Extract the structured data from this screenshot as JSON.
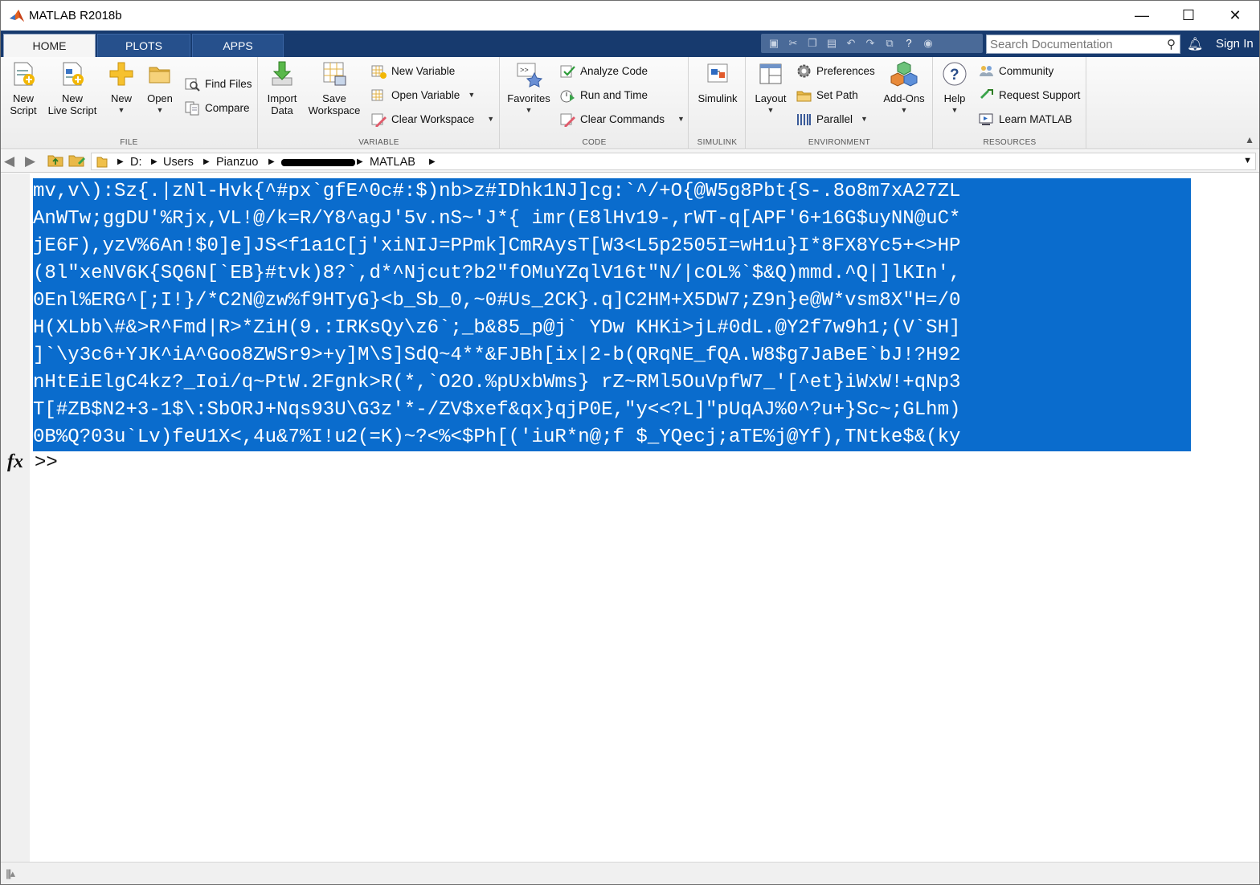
{
  "window": {
    "title": "MATLAB R2018b",
    "minimize": "—",
    "maximize": "☐",
    "close": "✕"
  },
  "tabs": [
    {
      "label": "HOME",
      "active": true
    },
    {
      "label": "PLOTS",
      "active": false
    },
    {
      "label": "APPS",
      "active": false
    }
  ],
  "search": {
    "placeholder": "Search Documentation"
  },
  "account": {
    "sign_in": "Sign In"
  },
  "ribbon": {
    "file": {
      "label": "FILE",
      "new_script": [
        "New",
        "Script"
      ],
      "new_live_script": [
        "New",
        "Live Script"
      ],
      "new": "New",
      "open": "Open",
      "find_files": "Find Files",
      "compare": "Compare"
    },
    "variable": {
      "label": "VARIABLE",
      "import_data": [
        "Import",
        "Data"
      ],
      "save_workspace": [
        "Save",
        "Workspace"
      ],
      "new_variable": "New Variable",
      "open_variable": "Open Variable",
      "clear_workspace": "Clear Workspace"
    },
    "code": {
      "label": "CODE",
      "favorites": "Favorites",
      "analyze_code": "Analyze Code",
      "run_and_time": "Run and Time",
      "clear_commands": "Clear Commands"
    },
    "simulink": {
      "label": "SIMULINK",
      "simulink": "Simulink"
    },
    "environment": {
      "label": "ENVIRONMENT",
      "layout": "Layout",
      "preferences": "Preferences",
      "set_path": "Set Path",
      "parallel": "Parallel",
      "add_ons": "Add-Ons"
    },
    "resources": {
      "label": "RESOURCES",
      "help": "Help",
      "community": "Community",
      "request_support": "Request Support",
      "learn_matlab": "Learn MATLAB"
    }
  },
  "path": {
    "drive": "D:",
    "segments": [
      "Users",
      "Pianzuo",
      "MATLAB"
    ]
  },
  "command_window": {
    "lines": [
      "mv,v\\):Sz{.|zNl-Hvk{^#px`gfE^0c#:$)nb>z#IDhk1NJ]cg:`^/+O{@W5g8Pbt{S-.8o8m7xA27ZL",
      "AnWTw;ggDU'%Rjx,VL!@/k=R/Y8^agJ'5v.nS~'J*{ imr(E8lHv19-,rWT-q[APF'6+16G$uyNN@uC*",
      "jE6F),yzV%6An!$0]e]JS<f1a1C[j'xiNIJ=PPmk]CmRAysT[W3<L5p2505I=wH1u}I*8FX8Yc5+<>HP",
      "(8l\"xeNV6K{SQ6N[`EB}#tvk)8?`,d*^Njcut?b2\"fOMuYZqlV16t\"N/|cOL%`$&Q)mmd.^Q|]lKIn',",
      "0Enl%ERG^[;I!}/*C2N@zw%f9HTyG}<b_Sb_0,~0#Us_2CK}.q]C2HM+X5DW7;Z9n}e@W*vsm8X\"H=/0",
      "H(XLbb\\#&>R^Fmd|R>*ZiH(9.:IRKsQy\\z6`;_b&85_p@j` YDw KHKi>jL#0dL.@Y2f7w9h1;(V`SH]",
      "]`\\y3c6+YJK^iA^Goo8ZWSr9>+y]M\\S]SdQ~4**&FJBh[ix|2-b(QRqNE_fQA.W8$g7JaBeE`bJ!?H92",
      "nHtEiElgC4kz?_Ioi/q~PtW.2Fgnk>R(*,`O2O.%pUxbWms} rZ~RMl5OuVpfW7_'[^et}iWxW!+qNp3",
      "T[#ZB$N2+3-1$\\:SbORJ+Nqs93U\\G3z'*-/ZV$xef&qx}qjP0E,\"y<<?L]\"pUqAJ%0^?u+}Sc~;GLhm)",
      "0B%Q?03u`Lv)feU1X<,4u&7%I!u2(=K)~?<%<$Ph[('iuR*n@;f $_YQecj;aTE%j@Yf),TNtke$&(ky"
    ],
    "fx_label": "fx",
    "prompt": ">>"
  }
}
